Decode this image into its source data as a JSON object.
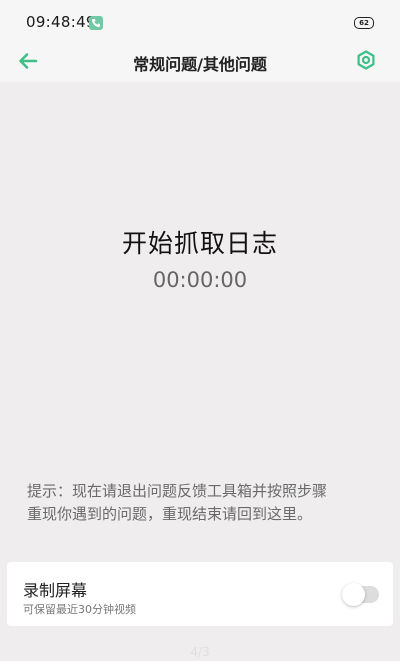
{
  "status_bar": {
    "time": "09:48:49",
    "battery": "62",
    "icons": [
      "phone-icon",
      "battery-icon"
    ]
  },
  "header": {
    "title": "常规问题/其他问题",
    "back_icon": "arrow-left-icon",
    "settings_icon": "gear-icon"
  },
  "main": {
    "title": "开始抓取日志",
    "timer": "00:00:00",
    "hint_line1": "提示：现在请退出问题反馈工具箱并按照步骤",
    "hint_line2": "重现你遇到的问题，重现结束请回到这里。"
  },
  "record_card": {
    "title": "录制屏幕",
    "subtitle": "可保留最近30分钟视频",
    "toggle_on": false
  },
  "footer": {
    "text": "4/3"
  },
  "colors": {
    "accent": "#3dbf88",
    "background": "#efeded",
    "bar": "#f6f6f6"
  }
}
